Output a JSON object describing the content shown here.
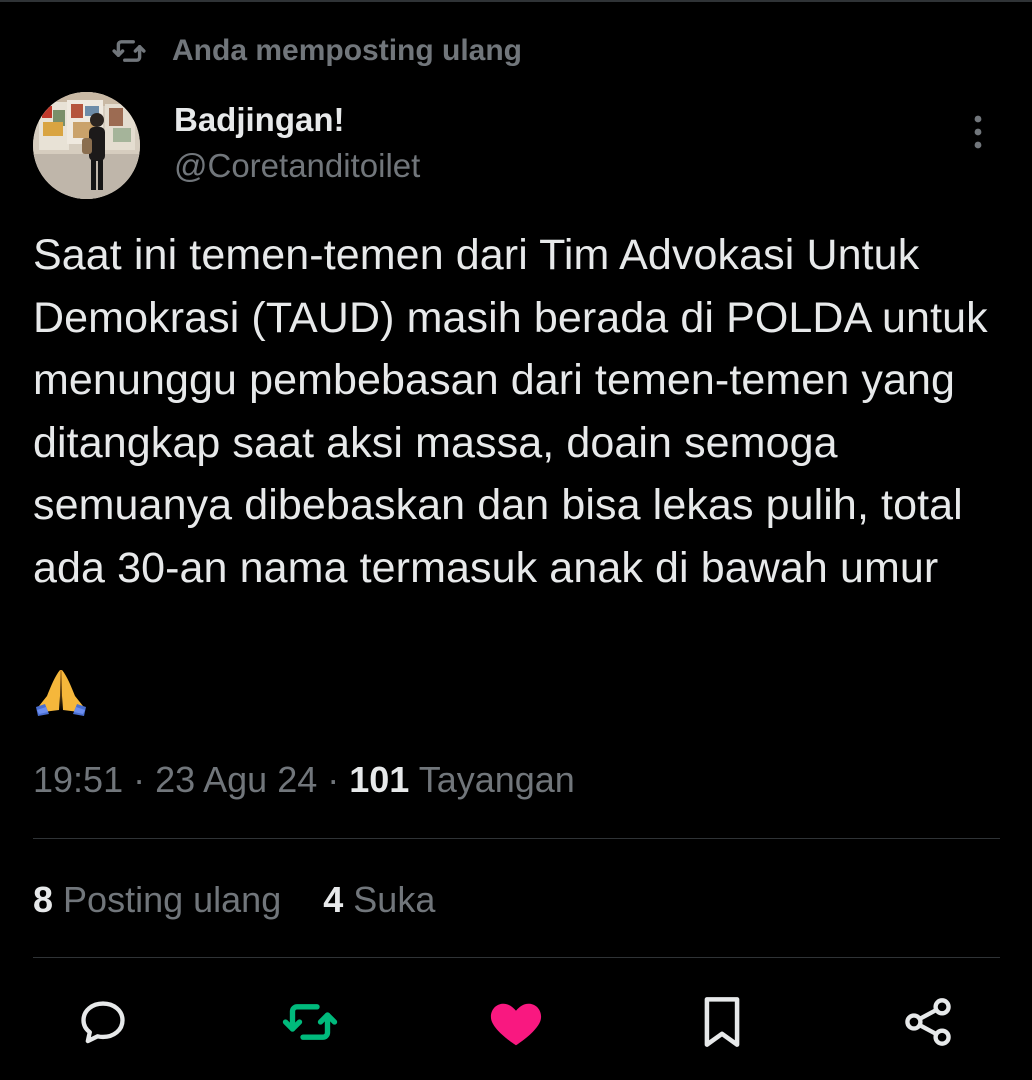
{
  "repost_context": {
    "label": "Anda memposting ulang",
    "icon": "repost-icon"
  },
  "author": {
    "name": "Badjingan!",
    "handle": "@Coretanditoilet"
  },
  "post": {
    "text": "Saat ini temen-temen dari Tim Advokasi Untuk Demokrasi (TAUD) masih berada di POLDA untuk menunggu pembebasan dari temen-temen yang ditangkap saat aksi massa, doain semoga semuanya dibebaskan dan bisa lekas pulih, total ada 30-an nama termasuk anak di bawah umur",
    "emoji": "folded-hands-emoji"
  },
  "meta": {
    "time": "19:51",
    "separator": " · ",
    "date": "23 Agu 24",
    "views_count": "101",
    "views_label": "Tayangan"
  },
  "stats": {
    "reposts_count": "8",
    "reposts_label": "Posting ulang",
    "likes_count": "4",
    "likes_label": "Suka"
  },
  "actions": [
    {
      "name": "reply",
      "icon": "reply-icon"
    },
    {
      "name": "repost",
      "icon": "repost-icon",
      "active_color": "#00ba7c"
    },
    {
      "name": "like",
      "icon": "heart-icon",
      "active_color": "#f91880"
    },
    {
      "name": "bookmark",
      "icon": "bookmark-icon"
    },
    {
      "name": "share",
      "icon": "share-icon"
    }
  ],
  "colors": {
    "background": "#000000",
    "text_primary": "#e7e9ea",
    "text_secondary": "#71767b",
    "divider": "#2f3336",
    "repost_active": "#00ba7c",
    "like_active": "#f91880"
  }
}
